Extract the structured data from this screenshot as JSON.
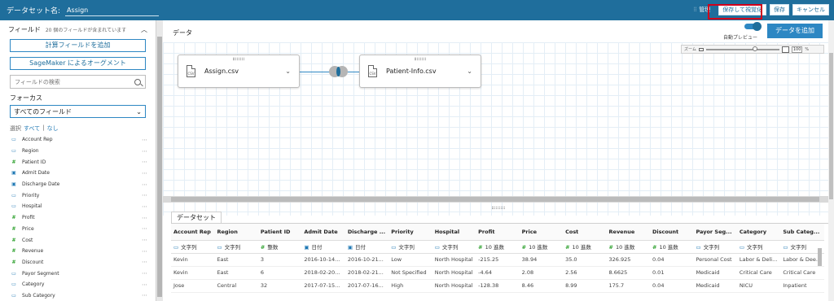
{
  "header": {
    "dataset_label": "データセット名:",
    "dataset_name": "Assign",
    "manage_label": "管理",
    "save_visualize": "保存して視覚化",
    "save": "保存",
    "cancel": "キャンセル"
  },
  "sidebar": {
    "title": "フィールド",
    "subtitle": "20 個のフィールドが含まれています",
    "add_calc_field": "計算フィールドを追加",
    "sagemaker": "SageMaker によるオーグメント",
    "search_placeholder": "フィールドの検索",
    "focus_label": "フォーカス",
    "focus_value": "すべてのフィールド",
    "select_label": "選択",
    "select_all": "すべて",
    "select_none": "なし",
    "fields": [
      {
        "name": "Account Rep",
        "type": "str"
      },
      {
        "name": "Region",
        "type": "str"
      },
      {
        "name": "Patient ID",
        "type": "num"
      },
      {
        "name": "Admit Date",
        "type": "date"
      },
      {
        "name": "Discharge Date",
        "type": "date"
      },
      {
        "name": "Priority",
        "type": "str"
      },
      {
        "name": "Hospital",
        "type": "str"
      },
      {
        "name": "Profit",
        "type": "num"
      },
      {
        "name": "Price",
        "type": "num"
      },
      {
        "name": "Cost",
        "type": "num"
      },
      {
        "name": "Revenue",
        "type": "num"
      },
      {
        "name": "Discount",
        "type": "num"
      },
      {
        "name": "Payor Segment",
        "type": "str"
      },
      {
        "name": "Category",
        "type": "str"
      },
      {
        "name": "Sub Category",
        "type": "str"
      }
    ],
    "more_icon": "⋯"
  },
  "main": {
    "title": "データ",
    "preview_label": "自動プレビュー",
    "add_data": "データを追加",
    "zoom_label": "ズーム",
    "zoom_value": "100",
    "zoom_unit": "%",
    "nodes": [
      {
        "name": "Assign.csv",
        "icon": "CSV"
      },
      {
        "name": "Patient-Info.csv",
        "icon": "CSV"
      }
    ]
  },
  "preview": {
    "tab": "データセット",
    "columns": [
      "Account Rep",
      "Region",
      "Patient ID",
      "Admit Date",
      "Discharge ...",
      "Priority",
      "Hospital",
      "Profit",
      "Price",
      "Cost",
      "Revenue",
      "Discount",
      "Payor Seg...",
      "Category",
      "Sub Categ..."
    ],
    "types": [
      {
        "icon": "str",
        "label": "文字列"
      },
      {
        "icon": "str",
        "label": "文字列"
      },
      {
        "icon": "num",
        "label": "整数"
      },
      {
        "icon": "date",
        "label": "日付"
      },
      {
        "icon": "date",
        "label": "日付"
      },
      {
        "icon": "str",
        "label": "文字列"
      },
      {
        "icon": "str",
        "label": "文字列"
      },
      {
        "icon": "num",
        "label": "10 進数"
      },
      {
        "icon": "num",
        "label": "10 進数"
      },
      {
        "icon": "num",
        "label": "10 進数"
      },
      {
        "icon": "num",
        "label": "10 進数"
      },
      {
        "icon": "num",
        "label": "10 進数"
      },
      {
        "icon": "str",
        "label": "文字列"
      },
      {
        "icon": "str",
        "label": "文字列"
      },
      {
        "icon": "str",
        "label": "文字列"
      }
    ],
    "rows": [
      [
        "Kevin",
        "East",
        "3",
        "2016-10-14...",
        "2016-10-21...",
        "Low",
        "North Hospital",
        "-215.25",
        "38.94",
        "35.0",
        "326.925",
        "0.04",
        "Personal Cost",
        "Labor & Deli...",
        "Labor & Dee..."
      ],
      [
        "Kevin",
        "East",
        "6",
        "2018-02-20...",
        "2018-02-21...",
        "Not Specified",
        "North Hospital",
        "-4.64",
        "2.08",
        "2.56",
        "8.6625",
        "0.01",
        "Medicaid",
        "Critical Care",
        "Critical Care"
      ],
      [
        "Jose",
        "Central",
        "32",
        "2017-07-15...",
        "2017-07-16...",
        "High",
        "North Hospital",
        "-128.38",
        "8.46",
        "8.99",
        "175.7",
        "0.04",
        "Medicaid",
        "NICU",
        "Inpatient"
      ]
    ]
  },
  "colors": {
    "header_bg": "#1f6e9c",
    "accent": "#2d87c3",
    "highlight": "#d0021b"
  }
}
